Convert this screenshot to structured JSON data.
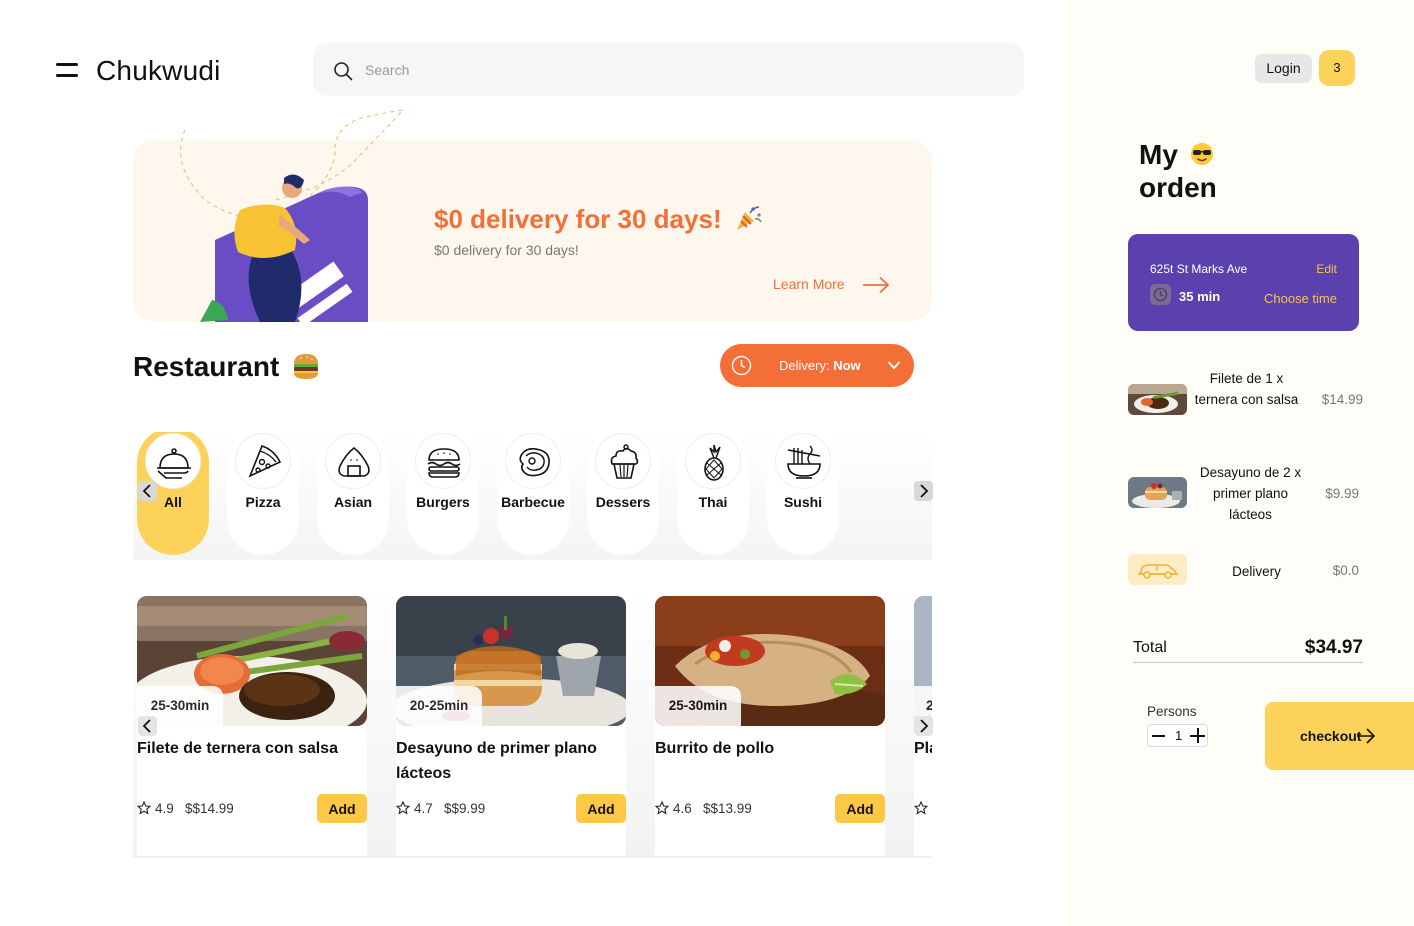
{
  "header": {
    "brand": "Chukwudi",
    "search_placeholder": "Search",
    "login_label": "Login",
    "cart_count": "3"
  },
  "banner": {
    "title": "$0 delivery for 30 days!",
    "subtitle": "$0 delivery for 30 days!",
    "learn_more": "Learn More"
  },
  "restaurant": {
    "title": "Restaurant",
    "delivery_label": "Delivery:",
    "delivery_value": "Now"
  },
  "categories": [
    {
      "label": "All",
      "icon": "cloche-icon",
      "active": true
    },
    {
      "label": "Pizza",
      "icon": "pizza-icon",
      "active": false
    },
    {
      "label": "Asian",
      "icon": "onigiri-icon",
      "active": false
    },
    {
      "label": "Burgers",
      "icon": "burger-icon",
      "active": false
    },
    {
      "label": "Barbecue",
      "icon": "steak-icon",
      "active": false
    },
    {
      "label": "Dessers",
      "icon": "cupcake-icon",
      "active": false
    },
    {
      "label": "Thai",
      "icon": "pineapple-icon",
      "active": false
    },
    {
      "label": "Sushi",
      "icon": "noodles-icon",
      "active": false
    }
  ],
  "foods": [
    {
      "time": "25-30min",
      "name": "Filete de ternera con salsa",
      "rating": "4.9",
      "price": "$$14.99",
      "add": "Add"
    },
    {
      "time": "20-25min",
      "name": "Desayuno de primer plano lácteos",
      "rating": "4.7",
      "price": "$$9.99",
      "add": "Add"
    },
    {
      "time": "25-30min",
      "name": "Burrito de pollo",
      "rating": "4.6",
      "price": "$$13.99",
      "add": "Add"
    },
    {
      "time": "2",
      "name": "Pla",
      "rating": "",
      "price": "",
      "add": ""
    }
  ],
  "order": {
    "title_line1": "My",
    "title_line2": "orden",
    "address": "625t St Marks Ave",
    "edit": "Edit",
    "minutes": "35 min",
    "choose_time": "Choose time",
    "items": [
      {
        "name": "Filete de 1 x ternera con salsa",
        "price": "$14.99"
      },
      {
        "name": "Desayuno de 2 x primer plano lácteos",
        "price": "$9.99"
      }
    ],
    "delivery_label": "Delivery",
    "delivery_price": "$0.0",
    "total_label": "Total",
    "total_value": "$34.97",
    "persons_label": "Persons",
    "persons_qty": "1",
    "checkout_label": "checkout"
  },
  "colors": {
    "accent_orange": "#f46f37",
    "accent_yellow": "#fcd25a",
    "purple": "#5a41ad",
    "banner_bg": "#fef7ee"
  }
}
